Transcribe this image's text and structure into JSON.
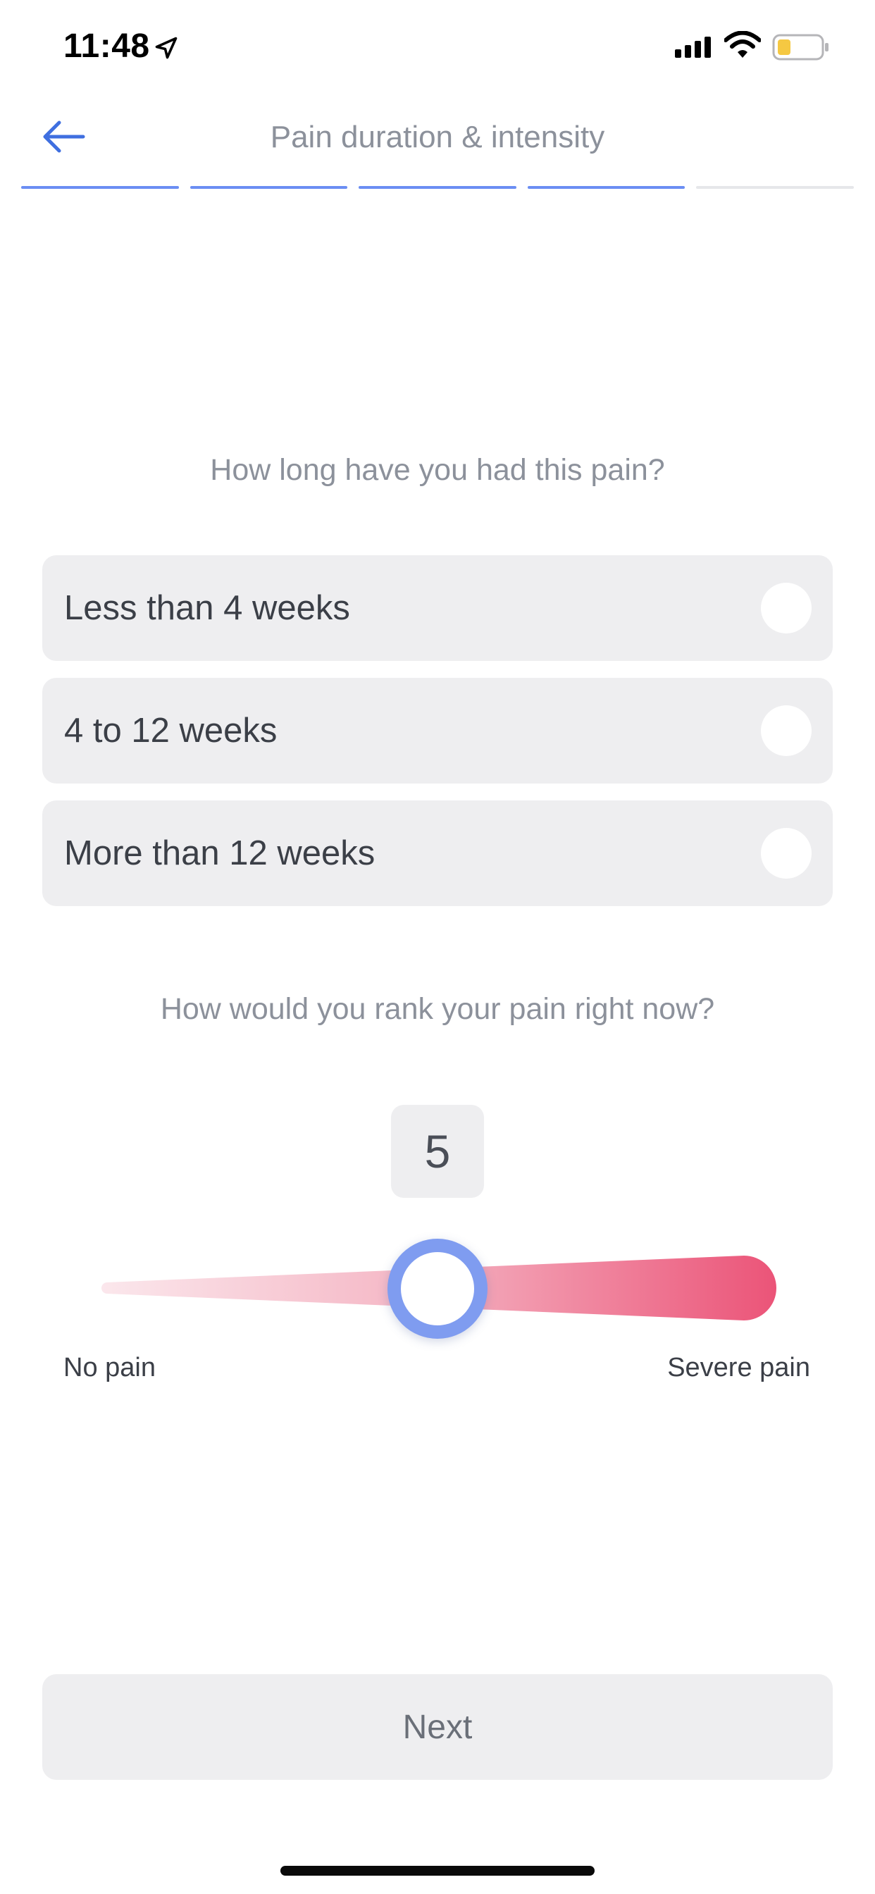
{
  "status_bar": {
    "time": "11:48",
    "icons": [
      "location-arrow-icon",
      "cellular-signal-icon",
      "wifi-icon",
      "battery-icon"
    ],
    "battery_color": "#f5c842"
  },
  "header": {
    "back_icon": "arrow-left-icon",
    "title": "Pain duration & intensity",
    "progress": {
      "total_steps": 5,
      "completed_steps": 4,
      "active_color": "#6b8ef3",
      "inactive_color": "#e6e7ea"
    }
  },
  "duration_question": {
    "prompt": "How long have you had this pain?",
    "options": [
      {
        "label": "Less than 4 weeks",
        "selected": false
      },
      {
        "label": "4 to 12 weeks",
        "selected": false
      },
      {
        "label": "More than 12 weeks",
        "selected": false
      }
    ]
  },
  "intensity_question": {
    "prompt": "How would you rank your pain right now?",
    "value": "5",
    "min_label": "No pain",
    "max_label": "Severe pain",
    "gradient_start_color": "#fbe7ec",
    "gradient_end_color": "#eb5478",
    "thumb_color": "#7f9cf0"
  },
  "footer": {
    "next_label": "Next"
  }
}
